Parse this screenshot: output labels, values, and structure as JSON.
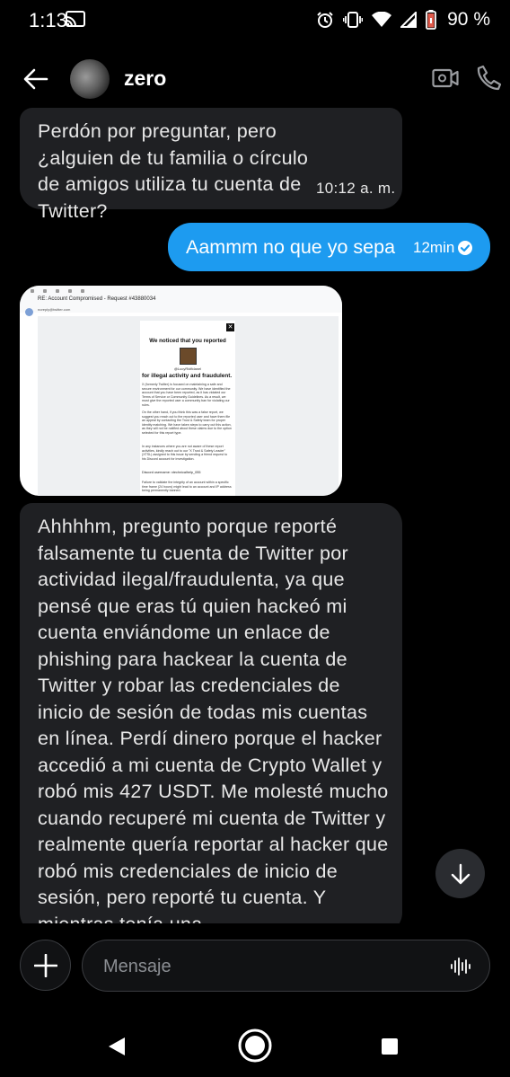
{
  "status_bar": {
    "time": "1:13",
    "battery": "90 %"
  },
  "header": {
    "contact_name": "zero"
  },
  "messages": [
    {
      "direction": "incoming",
      "text": "Perdón por preguntar, pero ¿alguien de tu familia o círculo de amigos utiliza tu cuenta de Twitter?",
      "time": "10:12 a. m."
    },
    {
      "direction": "outgoing",
      "text": "Aammm no que yo sepa",
      "time": "12min",
      "status": "read"
    },
    {
      "direction": "incoming",
      "type": "image",
      "image": {
        "subject": "RE: Account Compromised - Request #43880034",
        "sender_line": "noreply@twitter.com",
        "heading": "We noticed that you reported",
        "handle": "@LucyRidfidanel",
        "heading2": "for illegal activity and fraudulent.",
        "para1": "X (formerly Twitter) is focused on maintaining a safe and secure environment for our community. We have identified the account that you have been reported, as it has violated our Terms of Service or Community Guidelines. As a result, we must give the reported user a community ban for violating our rules.",
        "para2": "On the other hand, if you think this was a false report, we suggest you reach out to the reported user and have them file an appeal by contacting the Trust & Safety team for proper identity matching. We have taken steps to carry out this action, as they will not be notified about these claims due to the option selected for this report type.",
        "para3": "In any instances where you are not aware of these report activities, kindly reach out to our \"X Trust & Safety Leader\" (XTSL) assigned to this issue by sending a friend request to his Discord account for investigation.",
        "discord_line": "Discord username: xtechnicalhelp_055",
        "para4": "Failure to validate the integrity of an account within a specific time frame (24 hours) might lead to an account and IP address being permanently banned."
      }
    },
    {
      "direction": "incoming",
      "text": "Ahhhhm, pregunto porque reporté falsamente tu cuenta de Twitter por actividad ilegal/fraudulenta, ya que pensé que eras tú quien hackeó mi cuenta enviándome un enlace de phishing para hackear la cuenta de Twitter y robar las credenciales de inicio de sesión de todas mis cuentas en línea. Perdí dinero porque el hacker accedió a mi cuenta de Crypto Wallet y robó mis 427 USDT. Me molesté mucho cuando recuperé mi cuenta de Twitter y realmente quería reportar al hacker que robó mis credenciales de inicio de sesión, pero reporté tu cuenta. Y mientras tenía una"
    }
  ],
  "composer": {
    "placeholder": "Mensaje"
  },
  "colors": {
    "accent": "#1d9bf0",
    "incoming_bubble": "#1f2023",
    "background": "#000000"
  },
  "icons": {
    "status": [
      "cast-icon",
      "alarm-icon",
      "vibrate-icon",
      "wifi-icon",
      "signal-icon",
      "battery-icon"
    ],
    "header": [
      "back-arrow-icon",
      "video-call-icon",
      "phone-icon"
    ],
    "composer": [
      "plus-icon",
      "voice-wave-icon"
    ],
    "nav": [
      "nav-back-icon",
      "nav-home-icon",
      "nav-recents-icon"
    ]
  }
}
